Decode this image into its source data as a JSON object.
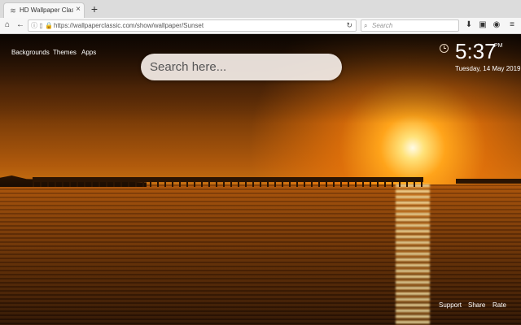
{
  "tab": {
    "title": "HD Wallpaper Classic - Sunset",
    "close": "×",
    "favicon": "wifi-favicon-icon"
  },
  "newtab_label": "+",
  "urlbar": {
    "url": "https://wallpaperclassic.com/show/wallpaper/Sunset"
  },
  "searchbar": {
    "placeholder": "Search"
  },
  "page": {
    "nav": [
      "Backgrounds",
      "Themes",
      "Apps"
    ],
    "search_placeholder": "Search here...",
    "clock": {
      "time": "5:37",
      "ampm": "PM",
      "date": "Tuesday, 14 May 2019"
    },
    "footer": [
      "Support",
      "Share",
      "Rate"
    ]
  },
  "colors": {
    "accent": "#f28a14",
    "sun": "#fff2c0"
  }
}
